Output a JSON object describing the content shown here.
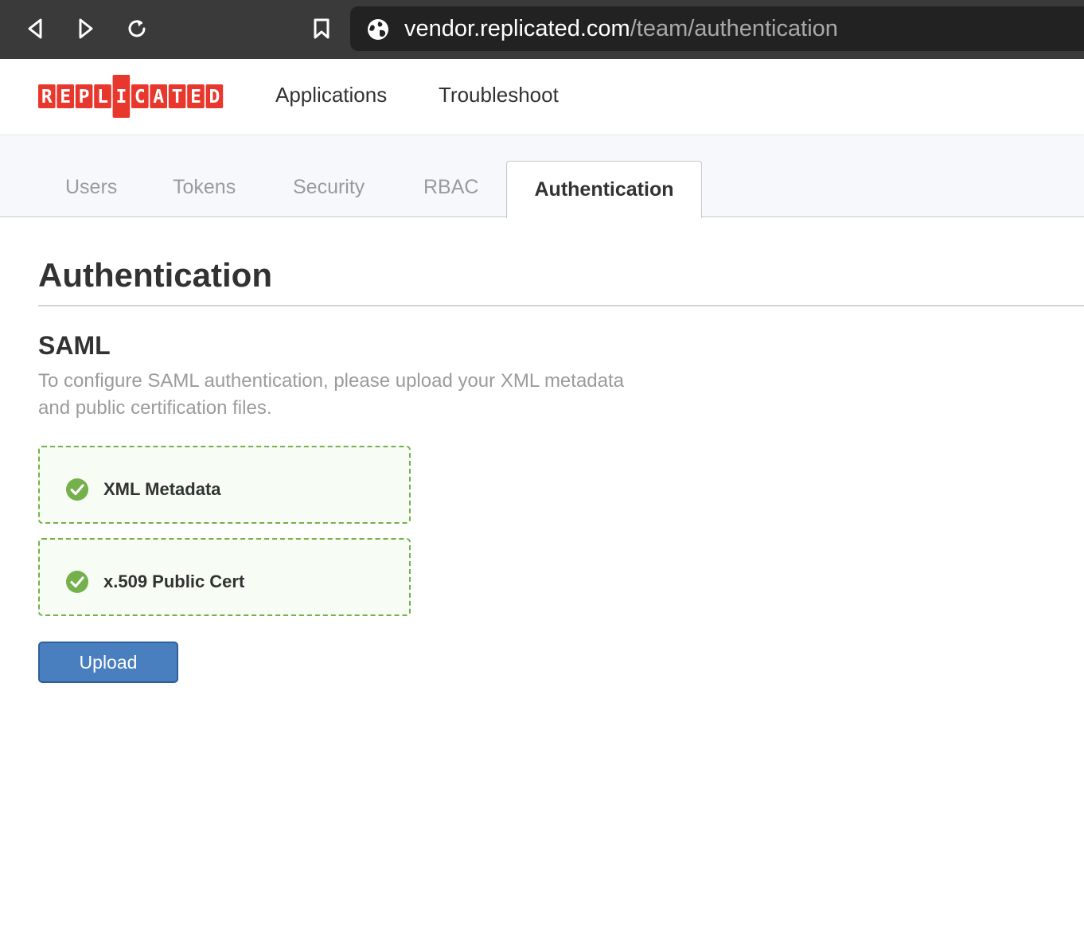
{
  "browser": {
    "url_host": "vendor.replicated.com",
    "url_path": "/team/authentication",
    "icons": [
      "back-icon",
      "forward-icon",
      "reload-icon",
      "bookmark-icon",
      "globe-icon"
    ]
  },
  "header": {
    "logo_letters": [
      "R",
      "E",
      "P",
      "L",
      "I",
      "C",
      "A",
      "T",
      "E",
      "D"
    ],
    "logo_color": "#e8372c",
    "nav": [
      "Applications",
      "Troubleshoot"
    ]
  },
  "tabs": {
    "items": [
      "Users",
      "Tokens",
      "Security",
      "RBAC"
    ],
    "active": "Authentication"
  },
  "main": {
    "title": "Authentication",
    "section_title": "SAML",
    "section_desc_line1": "To configure SAML authentication, please upload your XML metadata",
    "section_desc_line2": "and public certification files.",
    "files": [
      {
        "label": "XML Metadata",
        "status": "check-circle-icon"
      },
      {
        "label": "x.509 Public Cert",
        "status": "check-circle-icon"
      }
    ],
    "upload_label": "Upload"
  },
  "colors": {
    "success": "#74b04c",
    "primary": "#4a7fbf"
  }
}
